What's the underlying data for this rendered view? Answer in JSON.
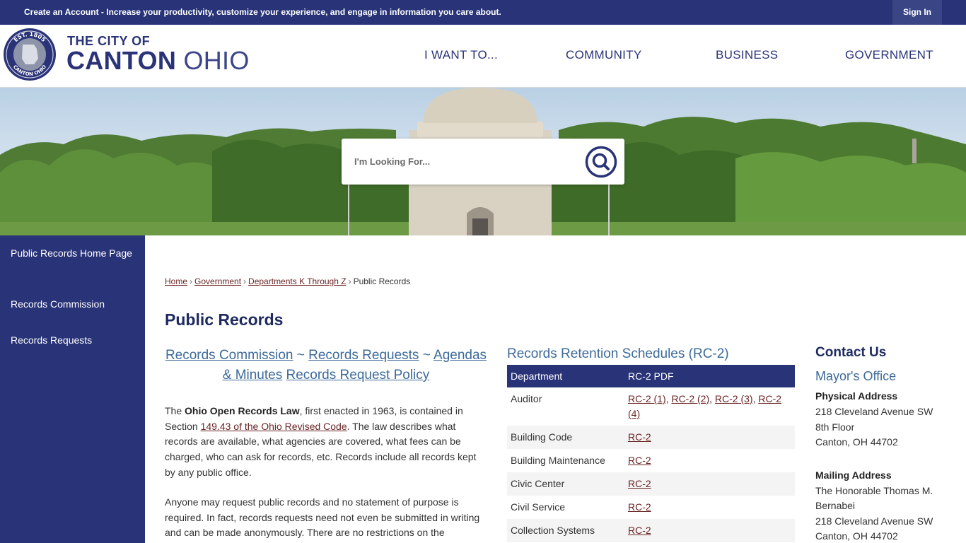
{
  "topbar": {
    "promo_link": "Create an Account",
    "promo_text": " - Increase your productivity, customize your experience, and engage in information you care about.",
    "signin": "Sign In"
  },
  "header": {
    "brand_top": "THE CITY OF",
    "brand_strong": "CANTON",
    "brand_light": " OHIO",
    "seal_text_top": "EST. 1805",
    "seal_text_bottom": "CANTON OHIO",
    "nav": [
      "I WANT TO...",
      "COMMUNITY",
      "BUSINESS",
      "GOVERNMENT"
    ]
  },
  "search": {
    "placeholder": "I'm Looking For..."
  },
  "sidebar": {
    "items": [
      "Public Records Home Page",
      "Records Commission",
      "Records Requests"
    ]
  },
  "breadcrumb": [
    "Home",
    "Government",
    "Departments K Through Z",
    "Public Records"
  ],
  "page_title": "Public Records",
  "quick_links": {
    "records_commission": "Records Commission",
    "tilde": " ~ ",
    "records_requests": "Records Requests",
    "agendas_1": "Agendas &",
    "agendas_2": "Minutes",
    "policy": "Records Request Policy"
  },
  "paragraphs": {
    "p1_a": "The ",
    "p1_bold": "Ohio Open Records Law",
    "p1_b": ", first enacted in 1963, is contained in Section ",
    "p1_link": "149.43 of the Ohio Revised Code",
    "p1_c": ". The law describes what records are available, what agencies are covered, what fees can be charged, who can ask for records, etc. Records include all records kept by any public office.",
    "p2": "Anyone may request public records and no statement of purpose is required. In fact, records requests need not even be submitted in writing and can be made anonymously. There are no restrictions on the"
  },
  "retention": {
    "title": "Records Retention Schedules (RC-2)",
    "headers": [
      "Department",
      "RC-2 PDF"
    ],
    "auditor": {
      "dept": "Auditor",
      "links": [
        "RC-2 (1)",
        "RC-2 (2)",
        "RC-2 (3)",
        "RC-2 (4)"
      ]
    },
    "rows": [
      {
        "dept": "Building Code",
        "link": "RC-2"
      },
      {
        "dept": "Building Maintenance",
        "link": "RC-2"
      },
      {
        "dept": "Civic Center",
        "link": "RC-2"
      },
      {
        "dept": "Civil Service",
        "link": "RC-2"
      },
      {
        "dept": "Collection Systems",
        "link": "RC-2"
      }
    ]
  },
  "contact": {
    "title": "Contact Us",
    "office": "Mayor's Office",
    "physical_label": "Physical Address",
    "physical": [
      "218 Cleveland Avenue SW",
      "8th Floor",
      "Canton, OH 44702"
    ],
    "mailing_label": "Mailing Address",
    "mailing": [
      "The Honorable Thomas M.",
      "Bernabei",
      "218 Cleveland Avenue SW",
      "Canton, OH 44702"
    ]
  },
  "colors": {
    "brand_navy": "#283378",
    "link_blue": "#3c6a9a",
    "link_maroon": "#6b2424"
  }
}
